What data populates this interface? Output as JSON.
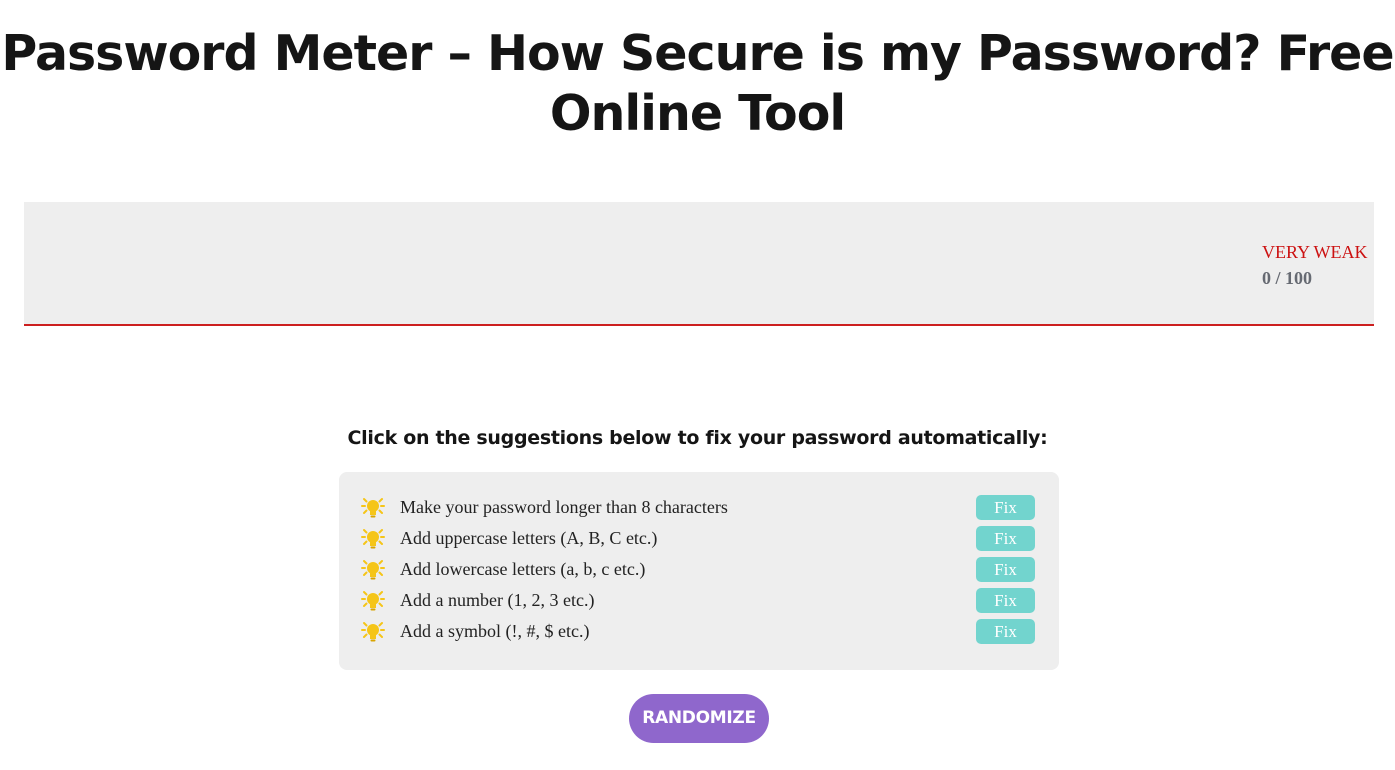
{
  "page": {
    "title": "Password Meter – How Secure is my Password? Free Online Tool"
  },
  "meter": {
    "password_value": "",
    "strength_label": "VERY WEAK",
    "score_text": "0 / 100",
    "strength_fraction": 0,
    "strength_color": "#cc1111",
    "bar_color": "#cc1f1f"
  },
  "suggestions": {
    "heading": "Click on the suggestions below to fix your password automatically:",
    "icon": "lightbulb-icon",
    "fix_color": "#72d4ce",
    "items": [
      {
        "text": "Make your password longer than 8 characters",
        "fix_label": "Fix"
      },
      {
        "text": "Add uppercase letters (A, B, C etc.)",
        "fix_label": "Fix"
      },
      {
        "text": "Add lowercase letters (a, b, c etc.)",
        "fix_label": "Fix"
      },
      {
        "text": "Add a number (1, 2, 3 etc.)",
        "fix_label": "Fix"
      },
      {
        "text": "Add a symbol (!, #, $ etc.)",
        "fix_label": "Fix"
      }
    ]
  },
  "actions": {
    "randomize_label": "RANDOMIZE",
    "randomize_color": "#8f67cc"
  }
}
